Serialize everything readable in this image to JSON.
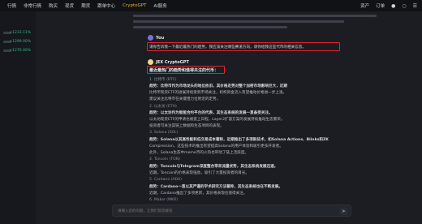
{
  "topnav": {
    "items": [
      "行情",
      "非常行情",
      "购买",
      "现货",
      "期货",
      "跟单中心",
      "CryptoGPT",
      "AI服务"
    ],
    "active_index": 6,
    "right_items": [
      "资产",
      "订单"
    ]
  },
  "sidebar": {
    "rows": [
      {
        "pct": "+1233.11%"
      },
      {
        "pct": "+1299.00%"
      },
      {
        "pct": "+1276.00%"
      }
    ]
  },
  "chat": {
    "user": {
      "name": "You",
      "question": "请你告诉我一下最近最热门的趋势，我应该关注哪些赛道方向，请你给我这些代币的相关信息。"
    },
    "bot": {
      "name": "JEX CryptoGPT",
      "heading": "最近最热门的趋势和值得关注的代币：",
      "lines": [
        {
          "style": "dim",
          "text": "1. 比特币 (BTC)"
        },
        {
          "style": "bold",
          "text": "趋势：比特币作为市场龙头的地位依旧，其价格走势对整个加密市场影响巨大，近期"
        },
        {
          "style": "",
          "text": "比特币现货ETF的进展持续受到市场关注，机构资金流入有望推动价格进一步上涨。"
        },
        {
          "style": "",
          "text": "建议关注比特币在关键阻力位附近的走势。"
        },
        {
          "style": "dim",
          "text": "2. 以太坊 (ETH)"
        },
        {
          "style": "bold",
          "text": "趋势：以太坊作为智能合约平台的代表，其生态系统的发展一直备受关注。"
        },
        {
          "style": "",
          "text": "以太坊现货ETF的申请也被提上日程，Layer2扩容方案的发展持续推动生态繁荣。"
        },
        {
          "style": "",
          "text": "投资者可关注其链上数据和生态项目的表现。"
        },
        {
          "style": "dim",
          "text": "3. Solana (SOL)"
        },
        {
          "style": "bold",
          "text": "趋势：Solana以其高性能和低交易成本著称，近期推出了多项新技术，如Solana Actions、Blinks和ZK"
        },
        {
          "style": "",
          "text": "Compression，这些技术的推出有望提高Solana的用户体验和吸引更多开发者。"
        },
        {
          "style": "",
          "text": "此外，Solana生态中meme币的火热也带动了链上活跃度。"
        },
        {
          "style": "dim",
          "text": "4. Toncoin (TON)"
        },
        {
          "style": "bold",
          "text": "趋势：Toncoin与Telegram深度整合带来流量优势，其生态系统发展迅速。"
        },
        {
          "style": "",
          "text": "近期，Toncoin的价格表现强劲，吸引了大量投资者的目光。"
        },
        {
          "style": "dim",
          "text": "5. Cardano (ADA)"
        },
        {
          "style": "bold",
          "text": "趋势：Cardano一直以其严谨的学术研究方法著称，其生态系统也在不断发展。"
        },
        {
          "style": "",
          "text": "近期，Cardano推出了多项更新，其价格表现也值得关注。"
        },
        {
          "style": "dim",
          "text": "6. Maker (MKR)"
        }
      ]
    }
  },
  "input": {
    "placeholder": "请输入您的问题，让我们帮您解答"
  },
  "colors": {
    "accent": "#e6b22f",
    "positive": "#2ebd85",
    "highlight_box": "#e0242c",
    "user_avatar": "#7b6fd6",
    "bot_avatar": "#f0d98a"
  }
}
